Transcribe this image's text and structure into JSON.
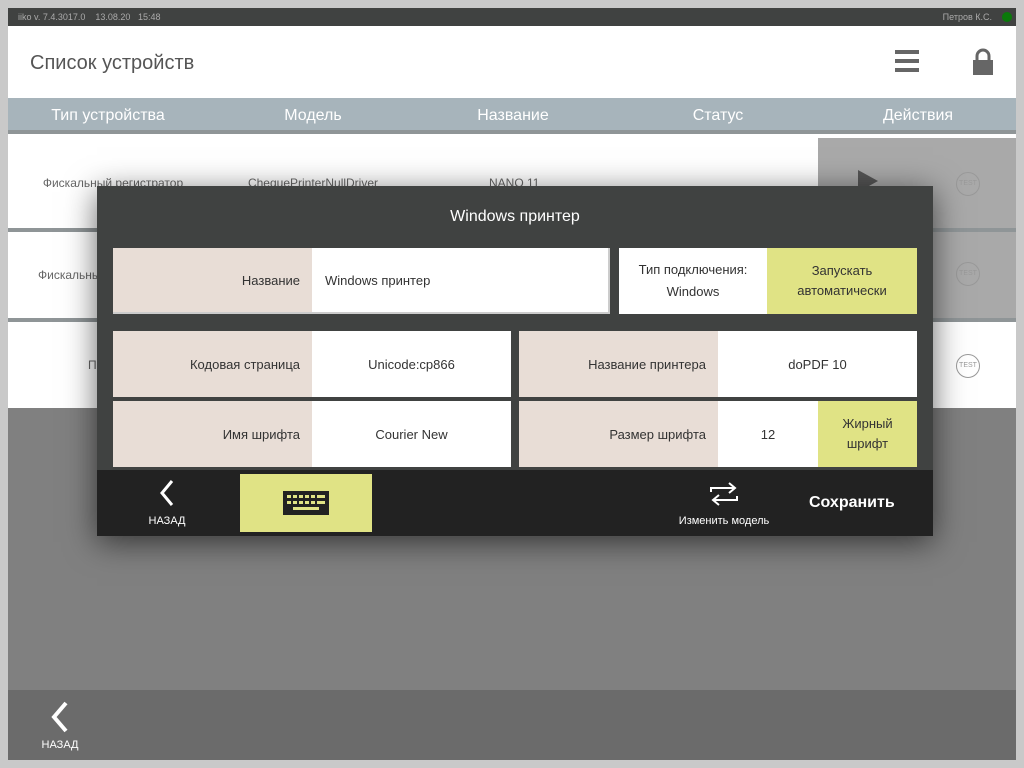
{
  "status_bar": {
    "version": "iiko  v. 7.4.3017.0",
    "date": "13.08.20",
    "time": "15:48",
    "user": "Петров К.С.",
    "status_color": "#0a7a0a"
  },
  "header": {
    "title": "Список устройств",
    "menu_icon": "hamburger-icon",
    "lock_icon": "lock-icon"
  },
  "columns": [
    "Тип устройства",
    "Модель",
    "Название",
    "Статус",
    "Действия"
  ],
  "rows": [
    {
      "type": "Фискальный регистратор",
      "model": "ChequePrinterNullDriver",
      "name": "NANO 11",
      "test": "TEST"
    },
    {
      "type": "Фискальны",
      "model": "",
      "name": "",
      "test": "TEST"
    },
    {
      "type": "Пр",
      "model": "",
      "name": "",
      "test": "TEST"
    }
  ],
  "footer": {
    "back": "НАЗАД"
  },
  "modal": {
    "title": "Windows принтер",
    "name_label": "Название",
    "name_value": "Windows принтер",
    "conn_label": "Тип подключения:",
    "conn_value": "Windows",
    "autostart": "Запускать автоматически",
    "codepage_label": "Кодовая страница",
    "codepage_value": "Unicode:cp866",
    "printer_label": "Название принтера",
    "printer_value": "doPDF 10",
    "font_label": "Имя шрифта",
    "font_value": "Courier New",
    "fontsize_label": "Размер шрифта",
    "fontsize_value": "12",
    "bold": "Жирный шрифт",
    "back": "НАЗАД",
    "change_model": "Изменить модель",
    "save": "Сохранить",
    "accent": "#e0e385"
  }
}
